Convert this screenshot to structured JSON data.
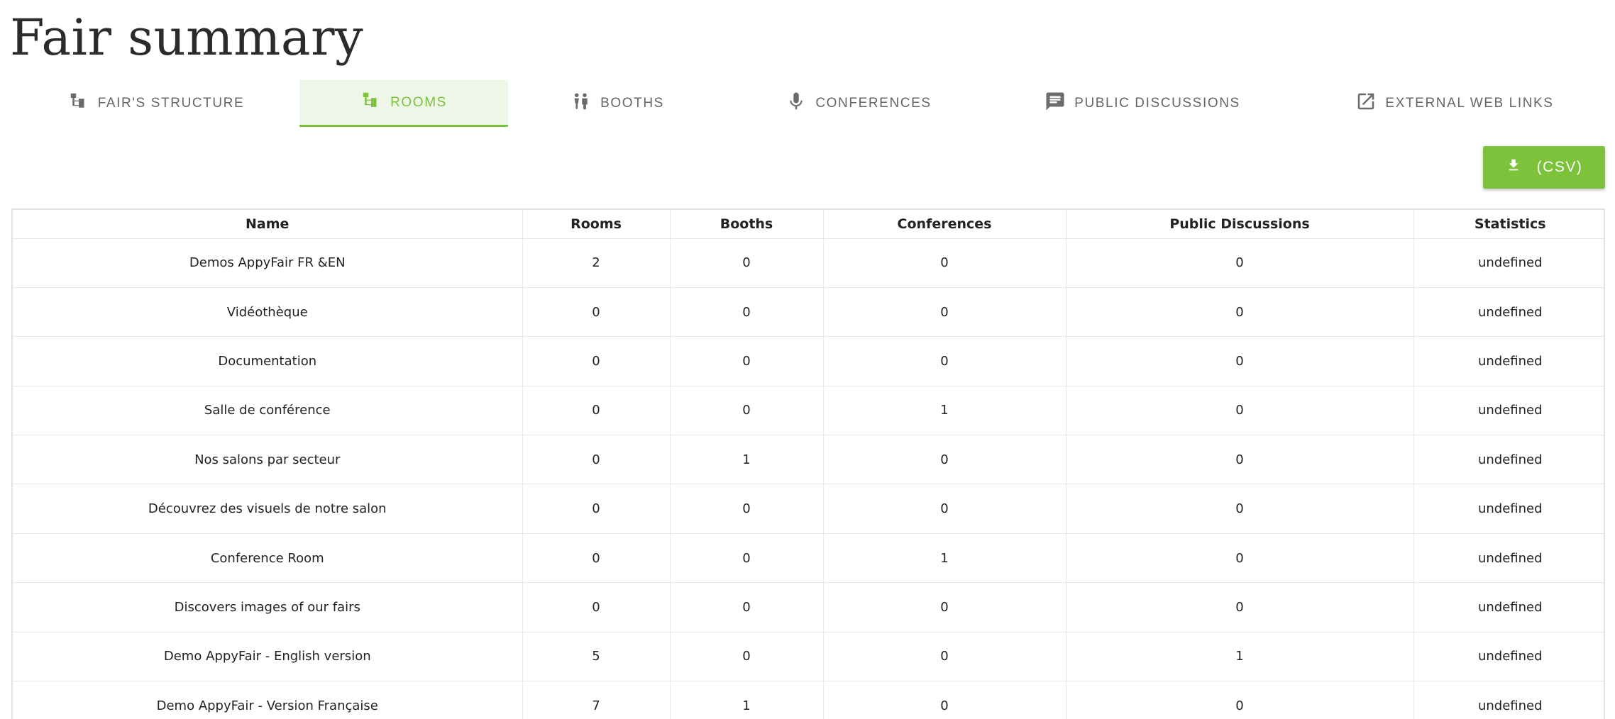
{
  "page_title": "Fair summary",
  "tabs": [
    {
      "label": "FAIR'S STRUCTURE",
      "icon": "tree-structure-icon",
      "active": false
    },
    {
      "label": "ROOMS",
      "icon": "tree-structure-icon",
      "active": true
    },
    {
      "label": "BOOTHS",
      "icon": "people-icon",
      "active": false
    },
    {
      "label": "CONFERENCES",
      "icon": "microphone-icon",
      "active": false
    },
    {
      "label": "PUBLIC DISCUSSIONS",
      "icon": "chat-bubble-icon",
      "active": false
    },
    {
      "label": "EXTERNAL WEB LINKS",
      "icon": "external-link-icon",
      "active": false
    }
  ],
  "csv_button": {
    "label": "(CSV)",
    "icon": "download-icon"
  },
  "table": {
    "headers": [
      "Name",
      "Rooms",
      "Booths",
      "Conferences",
      "Public Discussions",
      "Statistics"
    ],
    "rows": [
      [
        "Demos AppyFair FR &EN",
        "2",
        "0",
        "0",
        "0",
        "undefined"
      ],
      [
        "Vidéothèque",
        "0",
        "0",
        "0",
        "0",
        "undefined"
      ],
      [
        "Documentation",
        "0",
        "0",
        "0",
        "0",
        "undefined"
      ],
      [
        "Salle de conférence",
        "0",
        "0",
        "1",
        "0",
        "undefined"
      ],
      [
        "Nos salons par secteur",
        "0",
        "1",
        "0",
        "0",
        "undefined"
      ],
      [
        "Découvrez des visuels de notre salon",
        "0",
        "0",
        "0",
        "0",
        "undefined"
      ],
      [
        "Conference Room",
        "0",
        "0",
        "1",
        "0",
        "undefined"
      ],
      [
        "Discovers images of our fairs",
        "0",
        "0",
        "0",
        "0",
        "undefined"
      ],
      [
        "Demo AppyFair - English version",
        "5",
        "0",
        "0",
        "1",
        "undefined"
      ],
      [
        "Demo AppyFair - Version Française",
        "7",
        "1",
        "0",
        "0",
        "undefined"
      ]
    ]
  },
  "colors": {
    "accent": "#7cc23a",
    "active_tab_bg": "#eef6e8",
    "tab_text": "#666666"
  }
}
